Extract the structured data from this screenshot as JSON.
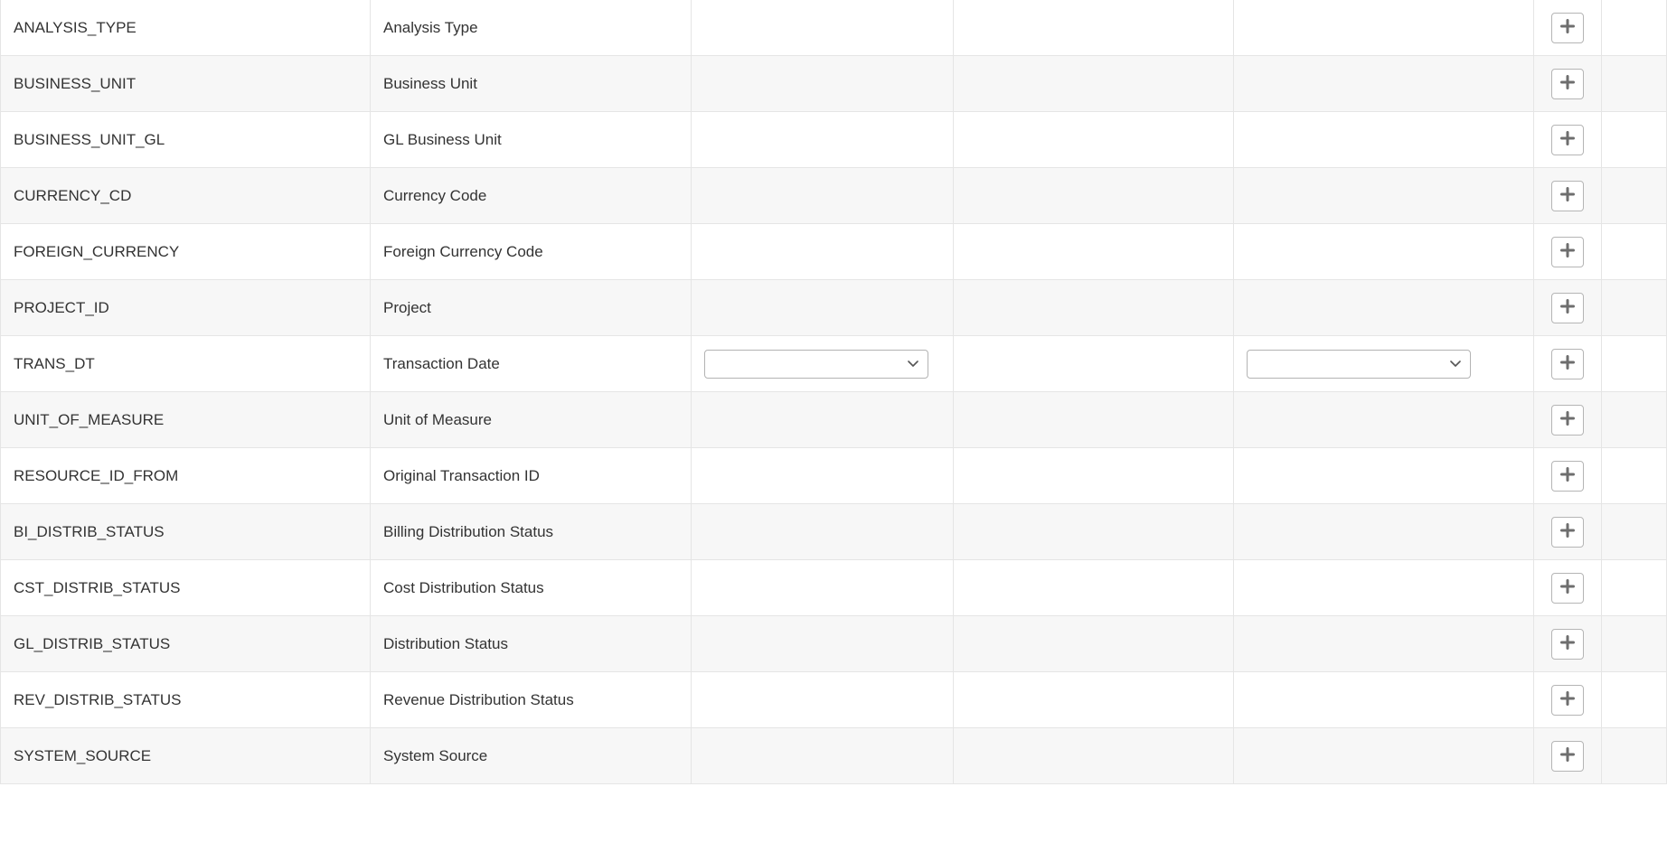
{
  "rows": [
    {
      "code": "ANALYSIS_TYPE",
      "label": "Analysis Type",
      "has_select_c3": false,
      "has_select_c5": false
    },
    {
      "code": "BUSINESS_UNIT",
      "label": "Business Unit",
      "has_select_c3": false,
      "has_select_c5": false
    },
    {
      "code": "BUSINESS_UNIT_GL",
      "label": "GL Business Unit",
      "has_select_c3": false,
      "has_select_c5": false
    },
    {
      "code": "CURRENCY_CD",
      "label": "Currency Code",
      "has_select_c3": false,
      "has_select_c5": false
    },
    {
      "code": "FOREIGN_CURRENCY",
      "label": "Foreign Currency Code",
      "has_select_c3": false,
      "has_select_c5": false
    },
    {
      "code": "PROJECT_ID",
      "label": "Project",
      "has_select_c3": false,
      "has_select_c5": false
    },
    {
      "code": "TRANS_DT",
      "label": "Transaction Date",
      "has_select_c3": true,
      "has_select_c5": true
    },
    {
      "code": "UNIT_OF_MEASURE",
      "label": "Unit of Measure",
      "has_select_c3": false,
      "has_select_c5": false
    },
    {
      "code": "RESOURCE_ID_FROM",
      "label": "Original Transaction ID",
      "has_select_c3": false,
      "has_select_c5": false
    },
    {
      "code": "BI_DISTRIB_STATUS",
      "label": "Billing Distribution Status",
      "has_select_c3": false,
      "has_select_c5": false
    },
    {
      "code": "CST_DISTRIB_STATUS",
      "label": "Cost Distribution Status",
      "has_select_c3": false,
      "has_select_c5": false
    },
    {
      "code": "GL_DISTRIB_STATUS",
      "label": "Distribution Status",
      "has_select_c3": false,
      "has_select_c5": false
    },
    {
      "code": "REV_DISTRIB_STATUS",
      "label": "Revenue Distribution Status",
      "has_select_c3": false,
      "has_select_c5": false
    },
    {
      "code": "SYSTEM_SOURCE",
      "label": "System Source",
      "has_select_c3": false,
      "has_select_c5": false
    }
  ]
}
